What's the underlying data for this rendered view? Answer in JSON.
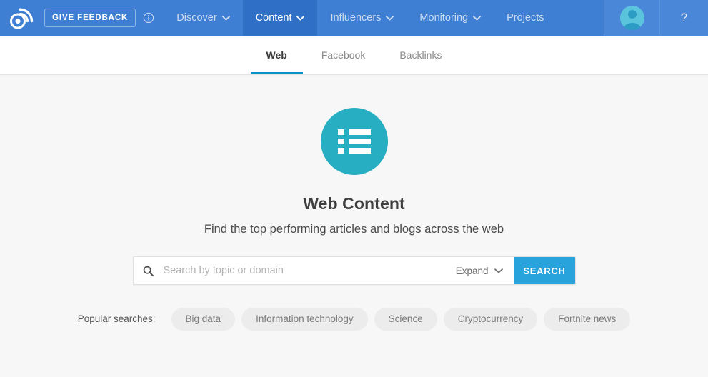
{
  "colors": {
    "navbar_bg": "#3e7fd4",
    "navbar_active_bg": "#2f6fc6",
    "accent_blue": "#29a3dc",
    "tab_underline": "#0e8fcc",
    "hero_icon_bg": "#28aec2",
    "page_bg": "#f7f7f7",
    "chip_bg": "#ececec"
  },
  "topnav": {
    "logo_name": "buzzsumo-rss-logo",
    "feedback_label": "GIVE  FEEDBACK",
    "info_icon": "info-circle-icon",
    "items": [
      {
        "label": "Discover",
        "has_caret": true,
        "active": false
      },
      {
        "label": "Content",
        "has_caret": true,
        "active": true
      },
      {
        "label": "Influencers",
        "has_caret": true,
        "active": false
      },
      {
        "label": "Monitoring",
        "has_caret": true,
        "active": false
      },
      {
        "label": "Projects",
        "has_caret": false,
        "active": false
      }
    ],
    "avatar_icon": "user-avatar-icon",
    "help_label": "?"
  },
  "tabs": [
    {
      "label": "Web",
      "active": true
    },
    {
      "label": "Facebook",
      "active": false
    },
    {
      "label": "Backlinks",
      "active": false
    }
  ],
  "hero": {
    "icon": "list-view-icon",
    "title": "Web Content",
    "subtitle": "Find the top performing articles and blogs across the web"
  },
  "search": {
    "icon": "search-icon",
    "value": "",
    "placeholder": "Search by topic or domain",
    "expand_label": "Expand",
    "expand_caret": "chevron-down-icon",
    "button_label": "SEARCH"
  },
  "popular": {
    "label": "Popular searches:",
    "chips": [
      "Big data",
      "Information technology",
      "Science",
      "Cryptocurrency",
      "Fortnite news"
    ]
  }
}
